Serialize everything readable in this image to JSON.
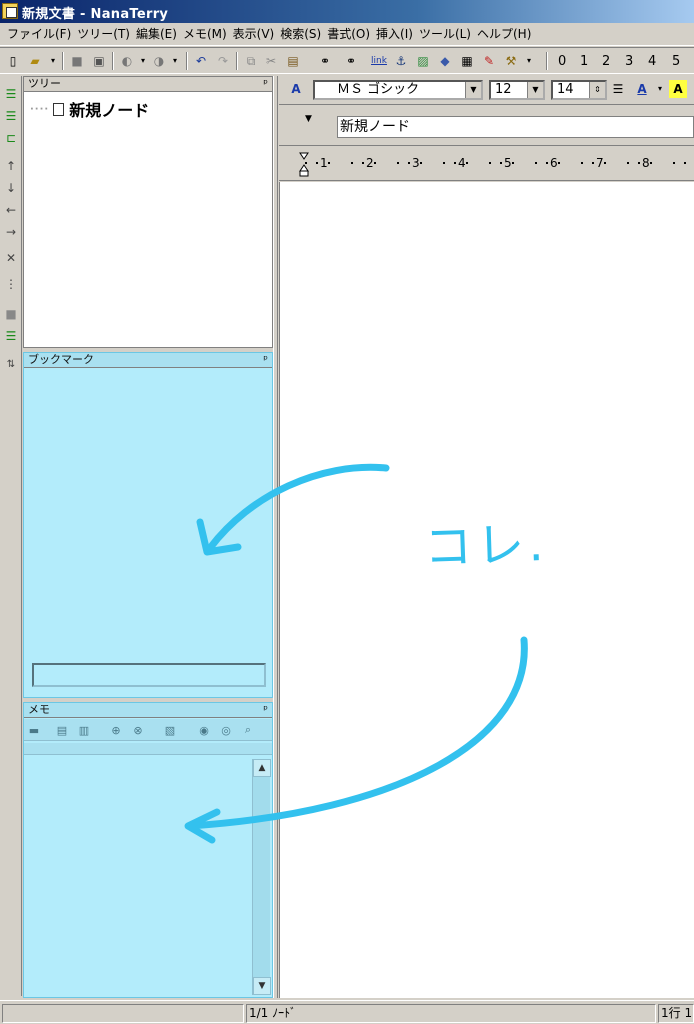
{
  "window": {
    "title": "新規文書 - NanaTerry"
  },
  "menu": {
    "items": [
      "ファイル(F)",
      "ツリー(T)",
      "編集(E)",
      "メモ(M)",
      "表示(V)",
      "検索(S)",
      "書式(O)",
      "挿入(I)",
      "ツール(L)",
      "ヘルプ(H)"
    ]
  },
  "toolbar": {
    "link_label": "link",
    "heading_levels": [
      "0",
      "1",
      "2",
      "3",
      "4",
      "5"
    ]
  },
  "tree_panel": {
    "title": "ツリー",
    "pin": "ᵖ",
    "nodes": [
      "新規ノード"
    ]
  },
  "bookmark_panel": {
    "title": "ブックマーク",
    "pin": "ᵖ"
  },
  "memo_panel": {
    "title": "メモ",
    "pin": "ᵖ"
  },
  "format_toolbar": {
    "font_name": "ＭＳ ゴシック",
    "font_size": "12",
    "spin_size": "14"
  },
  "node_title": {
    "value": "新規ノード"
  },
  "ruler": {
    "labels": [
      "1",
      "2",
      "3",
      "4",
      "5",
      "6",
      "7",
      "8"
    ]
  },
  "statusbar": {
    "node_count": "1/1 ﾉｰﾄﾞ",
    "position": "1行 1"
  },
  "annotation": {
    "text": "コレ.",
    "color": "#33c1ee"
  },
  "colors": {
    "highlight": "#b3ecfb",
    "titlebar": "#0a246a",
    "face": "#d4d0c8"
  }
}
